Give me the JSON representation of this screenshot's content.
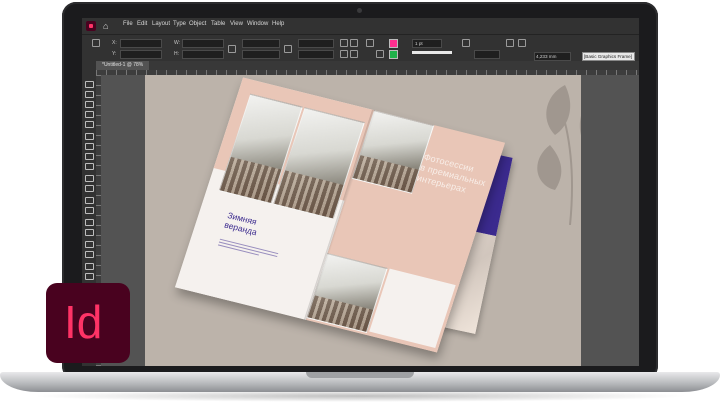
{
  "menubar": {
    "items": [
      "File",
      "Edit",
      "Layout",
      "Type",
      "Object",
      "Table",
      "View",
      "Window",
      "Help"
    ]
  },
  "control": {
    "x_label": "X:",
    "y_label": "Y:",
    "w_label": "W:",
    "h_label": "H:",
    "stroke_weight": "1 pt",
    "dimension_value": "4,233 mm",
    "frame_style": "[Basic Graphics Frame]"
  },
  "document_tab": {
    "label": "*Untitled-1 @ 78%"
  },
  "magazine": {
    "left_title_line1": "Зимняя",
    "left_title_line2": "веранда",
    "right_heading_line1": "Фотосессии",
    "right_heading_line2": "в премиальных",
    "right_heading_line3": "интерьерах"
  },
  "logo": {
    "text": "Id"
  },
  "colors": {
    "accent_pink": "#ff3366",
    "logo_bg": "#49021f",
    "brochure_blue": "#3b2a8e",
    "page_pink": "#e9c6b7",
    "canvas_bg": "#bcb3aa"
  }
}
